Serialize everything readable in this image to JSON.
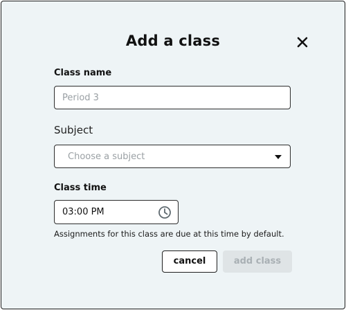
{
  "dialog": {
    "title": "Add a class",
    "close_icon": "close-icon"
  },
  "class_name": {
    "label": "Class name",
    "placeholder": "Period 3",
    "value": ""
  },
  "subject": {
    "label": "Subject",
    "placeholder": "Choose a subject",
    "icon": "chevron-down-icon"
  },
  "class_time": {
    "label": "Class time",
    "value": "03:00 PM",
    "icon": "clock-icon",
    "helper": "Assignments for this class are due at this time by default."
  },
  "actions": {
    "cancel_label": "cancel",
    "add_label": "add class"
  },
  "colors": {
    "background": "#eef4f6",
    "border": "#1e1e1e",
    "disabled_button": "#dfe4e6",
    "disabled_text": "#a9b0b4"
  }
}
